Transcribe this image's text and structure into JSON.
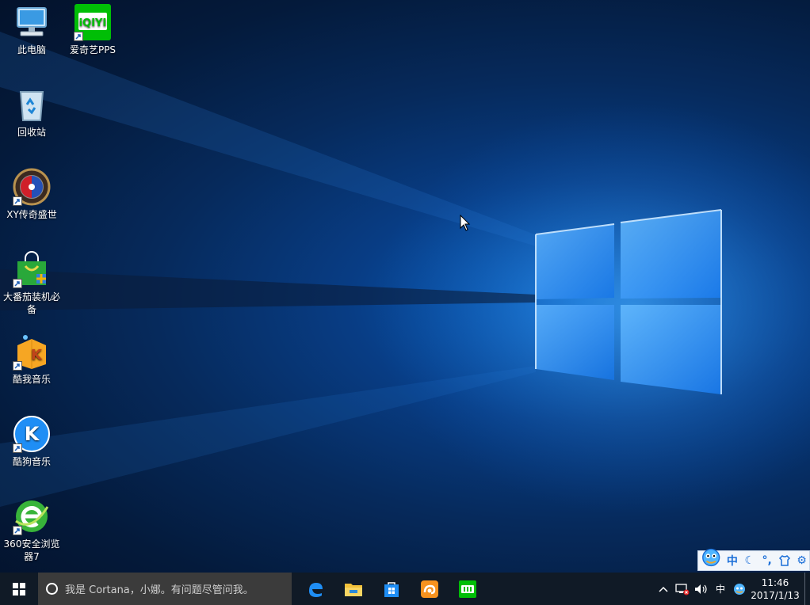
{
  "desktop": {
    "icons": [
      {
        "label": "此电脑",
        "icon": "computer-icon"
      },
      {
        "label": "爱奇艺PPS",
        "icon": "iqiyi-icon"
      },
      {
        "label": "回收站",
        "icon": "recycle-bin-icon"
      },
      {
        "label": "XY传奇盛世",
        "icon": "game-icon"
      },
      {
        "label": "大番茄装机必备",
        "icon": "shopping-bag-icon"
      },
      {
        "label": "酷我音乐",
        "icon": "kuwo-music-icon"
      },
      {
        "label": "酷狗音乐",
        "icon": "kugou-music-icon"
      },
      {
        "label": "360安全浏览器7",
        "icon": "browser-360-icon"
      }
    ],
    "iqiyi_logo_text": "iQIYI"
  },
  "ime_bar": {
    "mode_label": "中",
    "icons": [
      "mascot-icon",
      "moon-icon",
      "punctuation-icon",
      "shirt-icon",
      "settings-icon"
    ]
  },
  "taskbar": {
    "search_placeholder": "我是 Cortana，小娜。有问题尽管问我。",
    "pinned": [
      "edge-icon",
      "file-explorer-icon",
      "store-icon",
      "uc-browser-icon",
      "iqiyi-icon"
    ],
    "tray": {
      "ime_label": "中",
      "time": "11:46",
      "date": "2017/1/13"
    }
  },
  "colors": {
    "taskbar_bg": "#101a26",
    "search_bg": "#3b3b3b",
    "iqiyi_green": "#00be06"
  }
}
